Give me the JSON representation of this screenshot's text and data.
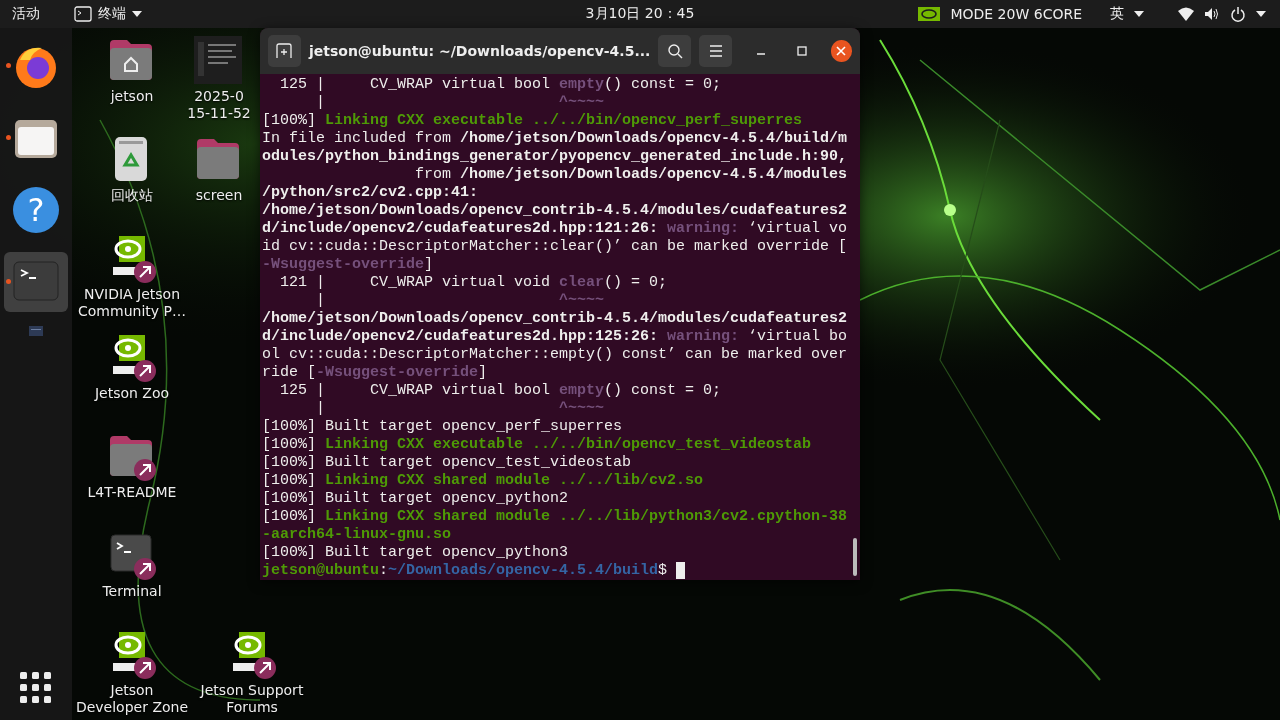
{
  "top_bar": {
    "activities": "活动",
    "app_menu": "终端",
    "clock": "3月10日  20：45",
    "power_mode": "MODE 20W 6CORE",
    "input_method": "英"
  },
  "dock": {
    "items": [
      {
        "kind": "firefox",
        "running": true,
        "selected": false
      },
      {
        "kind": "files",
        "running": true,
        "selected": false
      },
      {
        "kind": "help",
        "glyph": "?",
        "running": false,
        "selected": false
      },
      {
        "kind": "terminal",
        "running": true,
        "selected": true
      }
    ]
  },
  "desktop_icons": {
    "rows": [
      {
        "icons": [
          {
            "kind": "home-folder",
            "label": "jetson",
            "shortcut": false
          },
          {
            "kind": "screenshot",
            "label": "2025-0",
            "sublabel": "15-11-52",
            "shortcut": false
          }
        ]
      },
      {
        "icons": [
          {
            "kind": "trash",
            "label": "回收站",
            "shortcut": false
          },
          {
            "kind": "folder",
            "label": "screen",
            "shortcut": false
          }
        ]
      },
      {
        "icons": [
          {
            "kind": "nvidia",
            "label": "NVIDIA Jetson",
            "sublabel": "Community P…",
            "shortcut": true
          }
        ]
      },
      {
        "icons": [
          {
            "kind": "nvidia",
            "label": "Jetson Zoo",
            "shortcut": true
          }
        ]
      },
      {
        "icons": [
          {
            "kind": "folder",
            "label": "L4T-README",
            "shortcut": true
          }
        ]
      },
      {
        "icons": [
          {
            "kind": "terminal",
            "label": "Terminal",
            "shortcut": true
          }
        ]
      },
      {
        "icons": [
          {
            "kind": "nvidia",
            "label": "Jetson",
            "sublabel": "Developer Zone",
            "shortcut": true
          },
          {
            "kind": "nvidia",
            "label": "Jetson Support",
            "sublabel": "Forums",
            "shortcut": true
          }
        ]
      }
    ]
  },
  "terminal": {
    "title": "jetson@ubuntu: ~/Downloads/opencv-4.5...",
    "cursor_visible": true,
    "lines": [
      [
        {
          "kind": "plain",
          "text": "  125 |     CV_WRAP virtual bool "
        },
        {
          "kind": "hint",
          "text": "empty"
        },
        {
          "kind": "plain",
          "text": "() const = 0;"
        }
      ],
      [
        {
          "kind": "plain",
          "text": "      |                          "
        },
        {
          "kind": "hint",
          "text": "^~~~~"
        }
      ],
      [
        {
          "kind": "plain",
          "text": "[100%] "
        },
        {
          "kind": "green",
          "text": "Linking CXX executable ../../bin/opencv_perf_superres"
        }
      ],
      [
        {
          "kind": "plain",
          "text": "In file included from "
        },
        {
          "kind": "bold",
          "text": "/home/jetson/Downloads/opencv-4.5.4/build/m"
        }
      ],
      [
        {
          "kind": "bold",
          "text": "odules/python_bindings_generator/pyopencv_generated_include.h:90,"
        }
      ],
      [
        {
          "kind": "plain",
          "text": "                 from "
        },
        {
          "kind": "bold",
          "text": "/home/jetson/Downloads/opencv-4.5.4/modules"
        }
      ],
      [
        {
          "kind": "bold",
          "text": "/python/src2/cv2.cpp:41:"
        }
      ],
      [
        {
          "kind": "bold",
          "text": "/home/jetson/Downloads/opencv_contrib-4.5.4/modules/cudafeatures2"
        }
      ],
      [
        {
          "kind": "bold",
          "text": "d/include/opencv2/cudafeatures2d.hpp:121:26: "
        },
        {
          "kind": "warning",
          "text": "warning: "
        },
        {
          "kind": "plain",
          "text": "‘virtual vo"
        }
      ],
      [
        {
          "kind": "plain",
          "text": "id cv::cuda::DescriptorMatcher::clear()’ can be marked override ["
        }
      ],
      [
        {
          "kind": "warning",
          "text": "-Wsuggest-override"
        },
        {
          "kind": "plain",
          "text": "]"
        }
      ],
      [
        {
          "kind": "plain",
          "text": "  121 |     CV_WRAP virtual void "
        },
        {
          "kind": "hint",
          "text": "clear"
        },
        {
          "kind": "plain",
          "text": "() = 0;"
        }
      ],
      [
        {
          "kind": "plain",
          "text": "      |                          "
        },
        {
          "kind": "hint",
          "text": "^~~~~"
        }
      ],
      [
        {
          "kind": "bold",
          "text": "/home/jetson/Downloads/opencv_contrib-4.5.4/modules/cudafeatures2"
        }
      ],
      [
        {
          "kind": "bold",
          "text": "d/include/opencv2/cudafeatures2d.hpp:125:26: "
        },
        {
          "kind": "warning",
          "text": "warning: "
        },
        {
          "kind": "plain",
          "text": "‘virtual bo"
        }
      ],
      [
        {
          "kind": "plain",
          "text": "ol cv::cuda::DescriptorMatcher::empty() const’ can be marked over"
        }
      ],
      [
        {
          "kind": "plain",
          "text": "ride ["
        },
        {
          "kind": "warning",
          "text": "-Wsuggest-override"
        },
        {
          "kind": "plain",
          "text": "]"
        }
      ],
      [
        {
          "kind": "plain",
          "text": "  125 |     CV_WRAP virtual bool "
        },
        {
          "kind": "hint",
          "text": "empty"
        },
        {
          "kind": "plain",
          "text": "() const = 0;"
        }
      ],
      [
        {
          "kind": "plain",
          "text": "      |                          "
        },
        {
          "kind": "hint",
          "text": "^~~~~"
        }
      ],
      [
        {
          "kind": "plain",
          "text": "[100%] Built target opencv_perf_superres"
        }
      ],
      [
        {
          "kind": "plain",
          "text": "[100%] "
        },
        {
          "kind": "green",
          "text": "Linking CXX executable ../../bin/opencv_test_videostab"
        }
      ],
      [
        {
          "kind": "plain",
          "text": "[100%] Built target opencv_test_videostab"
        }
      ],
      [
        {
          "kind": "plain",
          "text": "[100%] "
        },
        {
          "kind": "green",
          "text": "Linking CXX shared module ../../lib/cv2.so"
        }
      ],
      [
        {
          "kind": "plain",
          "text": "[100%] Built target opencv_python2"
        }
      ],
      [
        {
          "kind": "plain",
          "text": "[100%] "
        },
        {
          "kind": "green",
          "text": "Linking CXX shared module ../../lib/python3/cv2.cpython-38"
        }
      ],
      [
        {
          "kind": "green",
          "text": "-aarch64-linux-gnu.so"
        }
      ],
      [
        {
          "kind": "plain",
          "text": "[100%] Built target opencv_python3"
        }
      ],
      [
        {
          "kind": "green",
          "text": "jetson@ubuntu"
        },
        {
          "kind": "plain",
          "text": ":"
        },
        {
          "kind": "path",
          "text": "~/Downloads/opencv-4.5.4/build"
        },
        {
          "kind": "plain",
          "text": "$ "
        }
      ]
    ]
  }
}
